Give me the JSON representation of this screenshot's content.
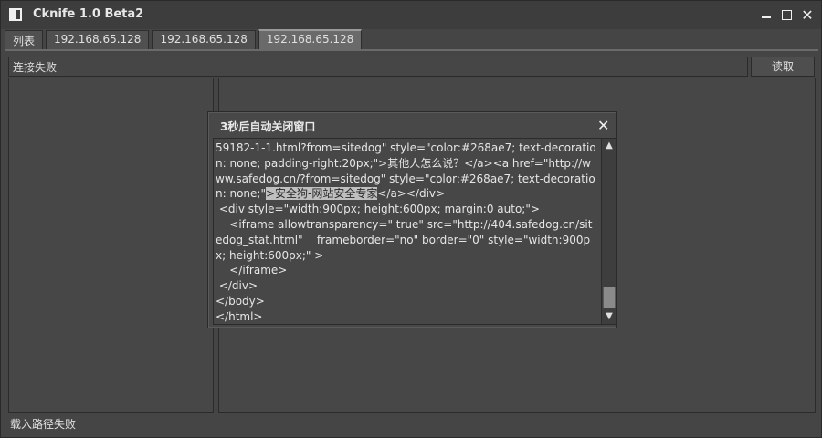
{
  "window": {
    "title": "Cknife 1.0 Beta2",
    "controls": {
      "minimize": "—",
      "maximize": "□",
      "close": "✕"
    }
  },
  "tabs": [
    {
      "label": "列表"
    },
    {
      "label": "192.168.65.128"
    },
    {
      "label": "192.168.65.128"
    },
    {
      "label": "192.168.65.128"
    }
  ],
  "address_bar": {
    "value": "连接失败"
  },
  "read_button": {
    "label": "读取"
  },
  "status_bar": {
    "text": "载入路径失败"
  },
  "dialog": {
    "title": "3秒后自动关闭窗口",
    "close": "✕",
    "content_before": "59182-1-1.html?from=sitedog\" style=\"color:#268ae7; text-decoration: none; padding-right:20px;\">其他人怎么说？</a><a href=\"http://www.safedog.cn/?from=sitedog\" style=\"color:#268ae7; text-decoration: none;\"",
    "content_highlight": ">安全狗-网站安全专家",
    "content_after": "</a></div>\n <div style=\"width:900px; height:600px; margin:0 auto;\">\n    <iframe allowtransparency=\" true\" src=\"http://404.safedog.cn/sitedog_stat.html\"    frameborder=\"no\" border=\"0\" style=\"width:900px; height:600px;\" >\n    </iframe>\n </div>\n</body>\n</html>"
  },
  "icons": {
    "app": "app-window-icon",
    "scroll_up": "chevron-up-icon",
    "scroll_down": "chevron-down-icon"
  }
}
